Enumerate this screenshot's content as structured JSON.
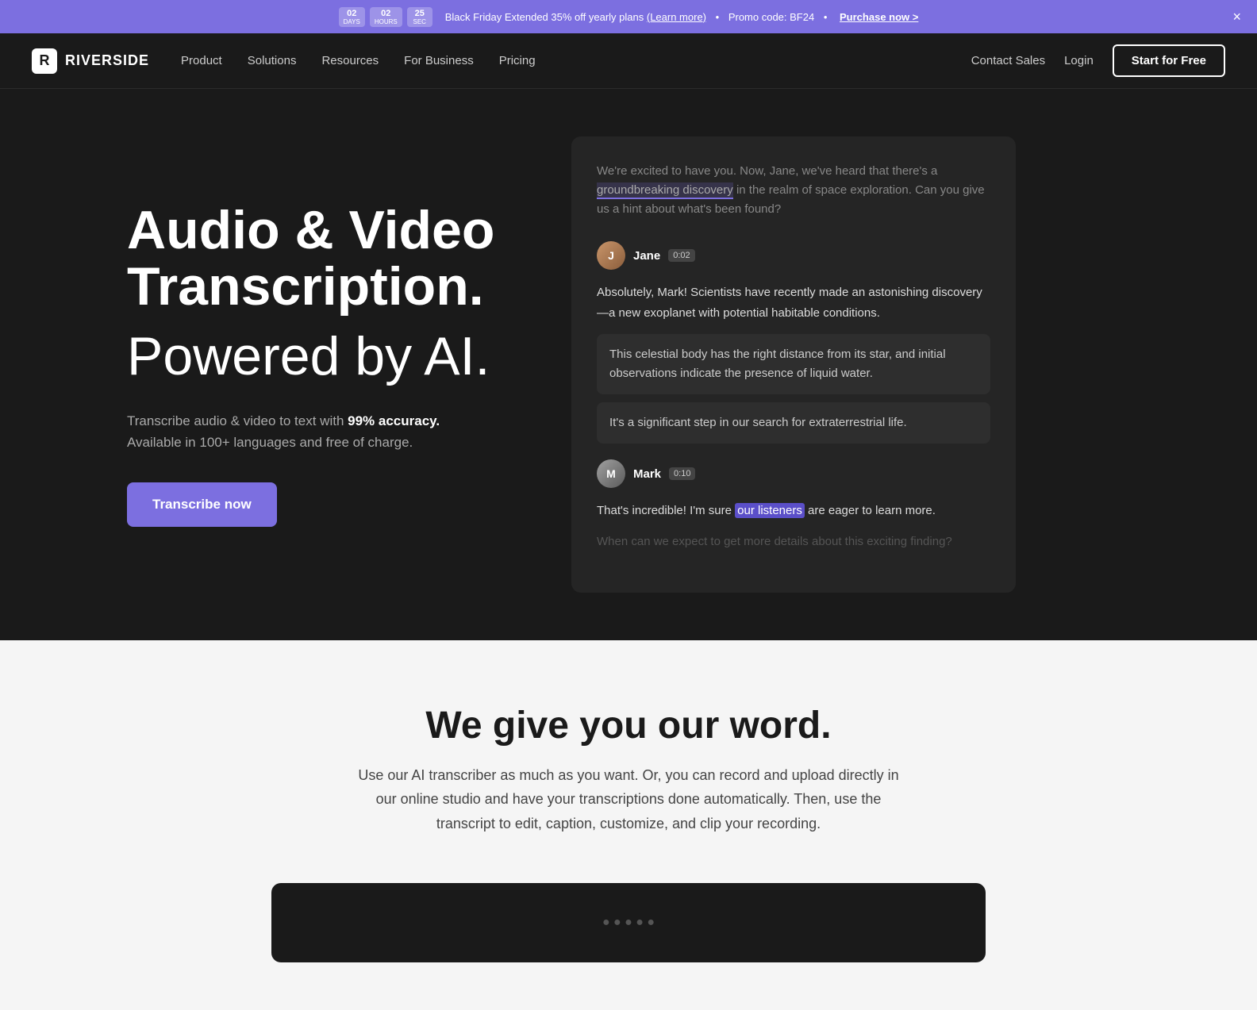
{
  "banner": {
    "timer_days_label": "DAYS",
    "timer_hours_label": "HOURS",
    "timer_sec_label": "SEC",
    "timer_days": "02",
    "timer_hours": "02",
    "timer_sec": "25",
    "text": "Black Friday Extended 35% off yearly plans",
    "learn_more": "(Learn more)",
    "promo_label": "Promo code: BF24",
    "purchase_label": "Purchase now >",
    "close_label": "×"
  },
  "nav": {
    "logo_text": "RIVERSIDE",
    "links": [
      "Product",
      "Solutions",
      "Resources",
      "For Business",
      "Pricing"
    ],
    "contact_label": "Contact Sales",
    "login_label": "Login",
    "cta_label": "Start for Free"
  },
  "hero": {
    "title_line1": "Audio & Video",
    "title_line2": "Transcription.",
    "subtitle": "Powered by AI.",
    "desc_prefix": "Transcribe audio & video to text with ",
    "desc_bold": "99% accuracy.",
    "desc_suffix": "\nAvailable in 100+ languages and free of charge.",
    "cta_label": "Transcribe now"
  },
  "transcript": {
    "intro_text_before": "We're excited to have you. Now, Jane, we've heard that there's a ",
    "intro_highlight": "groundbreaking discovery",
    "intro_text_after": " in the realm of space exploration. Can you give us a hint about what's been found?",
    "speakers": [
      {
        "name": "Jane",
        "time": "0:02",
        "initials": "J",
        "text_main": "Absolutely, Mark! Scientists have recently made an astonishing discovery—a new exoplanet with potential habitable conditions.",
        "bubbles": [
          "This celestial body has the right distance from its star, and initial observations indicate the presence of liquid water.",
          "It's a significant step in our search for extraterrestrial life."
        ]
      },
      {
        "name": "Mark",
        "time": "0:10",
        "initials": "M",
        "text_before": "That's incredible! I'm sure ",
        "text_highlight": "our listeners",
        "text_after": " are eager to learn more.",
        "text_faded": "When can we expect to get more details about this exciting finding?"
      }
    ]
  },
  "word_section": {
    "title": "We give you our word.",
    "desc": "Use our AI transcriber as much as you want. Or, you can record and upload directly in our online studio and have your transcriptions done automatically. Then, use the transcript to edit, caption, customize, and clip your recording.",
    "banner_placeholder": ""
  }
}
